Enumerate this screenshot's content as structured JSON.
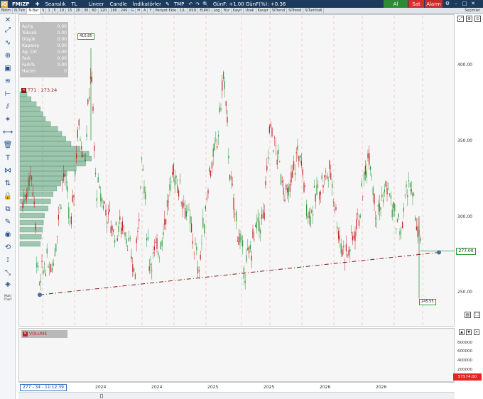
{
  "topbar": {
    "logo": "iQ",
    "symbol": "FMIZP",
    "plus": "✚",
    "session": "Seanslık",
    "currency": "TL",
    "scale": "Lineer",
    "candle": "Candle",
    "indicators": "İndikatörler",
    "tmp": "TMP",
    "change": "GünF: +1.00 GünF(%): +0.36",
    "buy": "Al",
    "sell": "Sat",
    "alarm": "Alarm"
  },
  "subbar": {
    "items": [
      "Birim",
      "N.Tick",
      "N.Bar",
      "S",
      "1",
      "5",
      "10",
      "15",
      "20",
      "30",
      "60",
      "120",
      "180",
      "240",
      "G",
      "H",
      "A",
      "Y",
      "Periyot Ekle",
      "1/L",
      "USD",
      "EURO",
      "Log",
      "Yüz",
      "Kayıt",
      "Uzak",
      "Kavşır",
      "SiTrend",
      "SiTrend",
      "SiTumIndi"
    ],
    "active_index": 2,
    "right_label": "Seçimler"
  },
  "info_box": [
    {
      "label": "Açılış",
      "value": "0.00"
    },
    {
      "label": "Yüksek",
      "value": "0.00"
    },
    {
      "label": "Düşük",
      "value": "0.00"
    },
    {
      "label": "Kapanış",
      "value": "0.00"
    },
    {
      "label": "Ağ. Ort",
      "value": "0.00"
    },
    {
      "label": "Fark",
      "value": "0.00"
    },
    {
      "label": "Fark%",
      "value": "0.00"
    },
    {
      "label": "Hacim",
      "value": "0"
    }
  ],
  "ma_label": "T71 : 273.24",
  "volume_label": "VOLUME",
  "price_axis": [
    "400.00",
    "350.00",
    "300.00",
    "250.00"
  ],
  "volume_axis": [
    "800000",
    "600000",
    "400000",
    "200000"
  ],
  "last_price_tag": "277.00",
  "high_tag": "410.85",
  "low_tag": "245.55",
  "volume_tag": "57574.00",
  "x_axis": [
    "2024",
    "2024",
    "2024",
    "2025",
    "2025",
    "2026",
    "2026"
  ],
  "cursor_label": "277 - 34 - 11:12:39",
  "toolbar_bottom_label": "Multi Chart",
  "colors": {
    "up": "#2e9a3a",
    "down": "#c42222",
    "volume": "#e62424",
    "ma": "#8b1a1a",
    "volume_profile": "#2e8b57",
    "header": "#1b3a5c"
  },
  "chart_data": {
    "type": "candlestick",
    "price_range": [
      240,
      420
    ],
    "trendline": {
      "start_price": 248,
      "end_price": 276
    },
    "last_price": 277.0,
    "high": 410.85,
    "low": 245.55,
    "x_labels": [
      "2024",
      "2024",
      "2024",
      "2025",
      "2025",
      "2026",
      "2026"
    ]
  }
}
